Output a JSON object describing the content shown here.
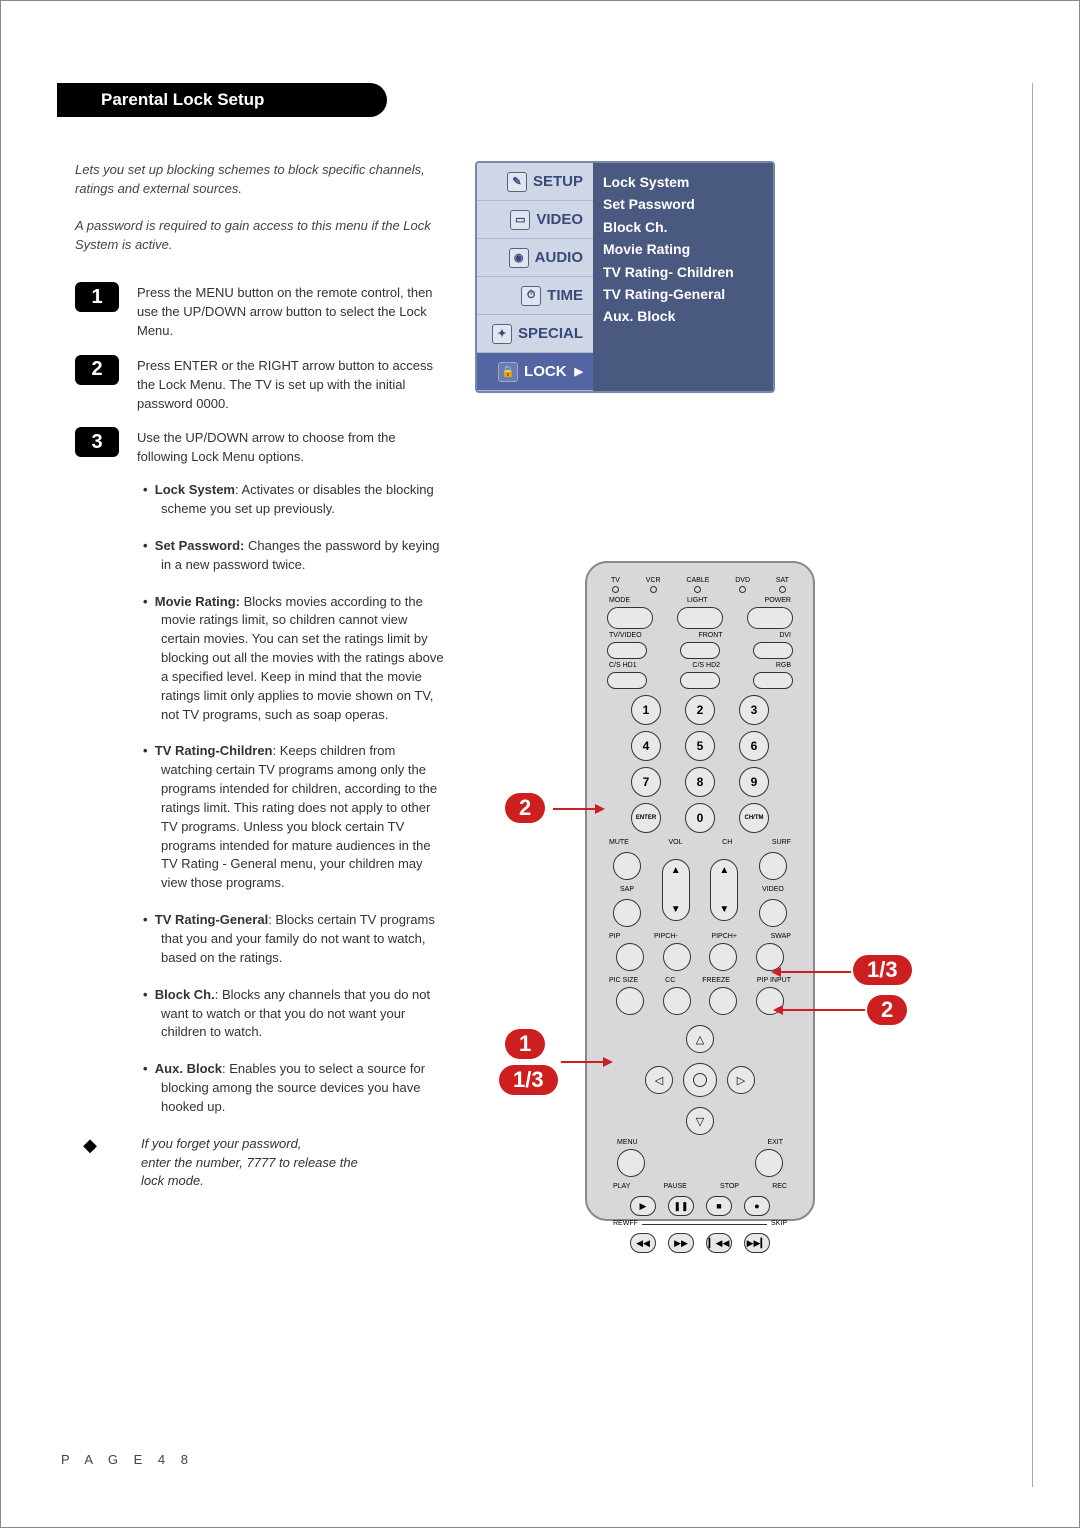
{
  "header": {
    "title": "Parental Lock Setup"
  },
  "intro": {
    "p1": "Lets you set up blocking schemes to block specific channels, ratings and external sources.",
    "p2": "A password is required to gain access to this menu if the Lock System is active."
  },
  "steps": [
    {
      "num": "1",
      "text": "Press the MENU button on the remote control, then use the UP/DOWN arrow button to select the Lock Menu."
    },
    {
      "num": "2",
      "text": "Press ENTER or the RIGHT arrow button to access the Lock Menu. The TV is set up with the initial password 0000."
    },
    {
      "num": "3",
      "text": "Use the UP/DOWN arrow to choose from the following Lock Menu options."
    }
  ],
  "bullets": [
    {
      "title": "Lock System",
      "body": ": Activates or disables the blocking scheme you set up previously."
    },
    {
      "title": "Set Password:",
      "body": " Changes the password by keying in a new password twice."
    },
    {
      "title": "Movie Rating:",
      "body": " Blocks movies according to the movie ratings limit, so children cannot view certain movies. You can set the ratings limit by blocking out all the movies with the ratings above a specified level. Keep in mind that the movie ratings limit only applies to movie shown on TV, not TV programs, such as soap operas."
    },
    {
      "title": "TV Rating-Children",
      "body": ": Keeps children from watching certain TV programs among only the programs intended for children, according to the ratings limit. This rating does not apply to other TV programs. Unless you block certain TV programs intended for mature audiences in the TV Rating - General menu, your children may view those programs."
    },
    {
      "title": "TV Rating-General",
      "body": ": Blocks certain TV programs that you and your family do not want to watch, based on the ratings."
    },
    {
      "title": "Block Ch.",
      "body": ": Blocks any channels that you do not want to  watch or that you do not want your children to watch."
    },
    {
      "title": "Aux. Block",
      "body": ": Enables you to select a source for blocking among the source devices you have hooked up."
    }
  ],
  "note": "If you forget your password,\nenter the number, 7777 to release the\nlock mode.",
  "osd": {
    "menu": [
      {
        "icon": "✎",
        "label": "SETUP"
      },
      {
        "icon": "▭",
        "label": "VIDEO"
      },
      {
        "icon": "◉",
        "label": "AUDIO"
      },
      {
        "icon": "⏱",
        "label": "TIME"
      },
      {
        "icon": "✦",
        "label": "SPECIAL"
      },
      {
        "icon": "🔒",
        "label": "LOCK",
        "selected": true,
        "arrow": "▶"
      }
    ],
    "options": [
      "Lock System",
      "Set Password",
      "Block Ch.",
      "Movie Rating",
      "TV Rating- Children",
      "TV Rating-General",
      "Aux. Block"
    ]
  },
  "remote": {
    "indicators": [
      "TV",
      "VCR",
      "CABLE",
      "DVD",
      "SAT"
    ],
    "row1": [
      "MODE",
      "LIGHT",
      "POWER"
    ],
    "row2": [
      "TV/VIDEO",
      "FRONT",
      "DVI"
    ],
    "row3": [
      "C/S HD1",
      "C/S HD2",
      "RGB"
    ],
    "numbers": [
      "1",
      "2",
      "3",
      "4",
      "5",
      "6",
      "7",
      "8",
      "9"
    ],
    "bottomNumRow": {
      "left": "ENTER",
      "mid": "0",
      "right": "CH/TM"
    },
    "volch_labels": [
      "MUTE",
      "VOL",
      "CH",
      "SURF"
    ],
    "side_labels": [
      "SAP",
      "VIDEO"
    ],
    "piprow": [
      "PIP",
      "PIPCH-",
      "PIPCH+",
      "SWAP"
    ],
    "row_pic": [
      "PIC SIZE",
      "CC",
      "FREEZE",
      "PIP INPUT"
    ],
    "menu_exit": [
      "MENU",
      "EXIT"
    ],
    "transport": [
      "PLAY",
      "PAUSE",
      "STOP",
      "REC"
    ],
    "transport2": [
      "REW",
      "FF",
      "SKIP",
      "SKIP"
    ],
    "trans_sym": [
      "▶",
      "❚❚",
      "■",
      "●"
    ],
    "trans2_sym": [
      "◀◀",
      "▶▶",
      "▎◀◀",
      "▶▶▎"
    ]
  },
  "callouts": {
    "c1": "1",
    "c2": "2",
    "c_13a": "1/3",
    "c_13b": "1/3",
    "c_2b": "2"
  },
  "footer": {
    "page": "P A G E   4 8"
  }
}
